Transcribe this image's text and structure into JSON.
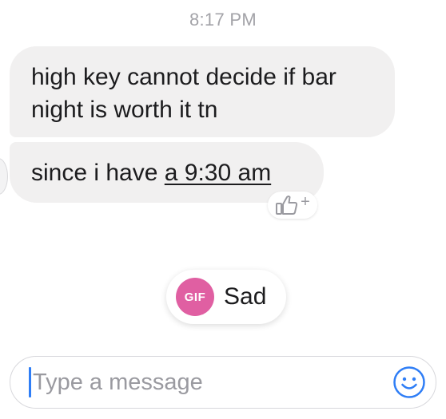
{
  "timestamp": "8:17 PM",
  "messages": [
    {
      "text": "high key cannot decide if bar night is worth it tn"
    },
    {
      "text_before_link": "since i have ",
      "link_text": "a 9:30 am"
    }
  ],
  "like_button": {
    "icon": "thumbs-up-icon",
    "plus": "+"
  },
  "suggestion": {
    "badge": "GIF",
    "label": "Sad",
    "badge_color": "#e05fa2"
  },
  "composer": {
    "placeholder": "Type a message",
    "value": "",
    "emoji_icon": "smiley-icon",
    "accent": "#2f7ef6"
  }
}
